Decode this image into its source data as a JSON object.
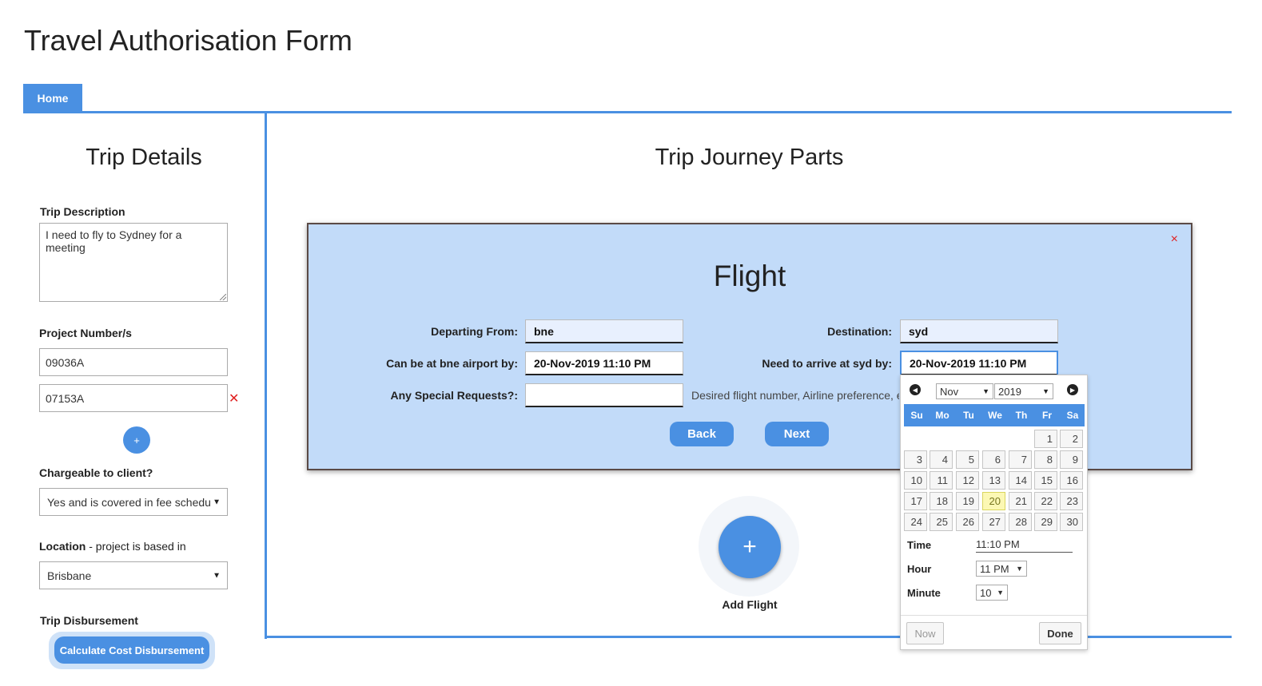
{
  "app": {
    "title": "Travel Authorisation Form"
  },
  "tabs": [
    {
      "label": "Home",
      "active": true
    }
  ],
  "left_panel": {
    "title": "Trip Details",
    "trip_description": {
      "label": "Trip Description",
      "value": "I need to fly to Sydney for a meeting"
    },
    "project_numbers": {
      "label": "Project Number/s",
      "values": [
        "09036A",
        "07153A"
      ],
      "remove_symbol": "✕",
      "add_symbol": "+"
    },
    "chargeable": {
      "label": "Chargeable to client?",
      "value": "Yes and is covered in fee schedu"
    },
    "location": {
      "label": "Location",
      "label_suffix": " - project is based in",
      "value": "Brisbane"
    },
    "disbursement": {
      "label": "Trip Disbursement",
      "button_label": "Calculate Cost Disbursement"
    }
  },
  "main": {
    "title": "Trip Journey Parts",
    "add_flight": {
      "symbol": "+",
      "label": "Add Flight"
    }
  },
  "flight_modal": {
    "title": "Flight",
    "close_symbol": "×",
    "departing_from": {
      "label": "Departing From:",
      "value": "bne"
    },
    "destination": {
      "label": "Destination:",
      "value": "syd"
    },
    "depart_by": {
      "label": "Can be at bne airport by:",
      "value": "20-Nov-2019 11:10 PM"
    },
    "arrive_by": {
      "label": "Need to arrive at syd by:",
      "value": "20-Nov-2019 11:10 PM"
    },
    "special_requests": {
      "label": "Any Special Requests?:",
      "value": "",
      "hint": "Desired flight number, Airline preference, e"
    },
    "back_label": "Back",
    "next_label": "Next"
  },
  "datepicker": {
    "month": "Nov",
    "year": "2019",
    "weekdays": [
      "Su",
      "Mo",
      "Tu",
      "We",
      "Th",
      "Fr",
      "Sa"
    ],
    "weeks": [
      [
        "",
        "",
        "",
        "",
        "",
        "1",
        "2"
      ],
      [
        "3",
        "4",
        "5",
        "6",
        "7",
        "8",
        "9"
      ],
      [
        "10",
        "11",
        "12",
        "13",
        "14",
        "15",
        "16"
      ],
      [
        "17",
        "18",
        "19",
        "20",
        "21",
        "22",
        "23"
      ],
      [
        "24",
        "25",
        "26",
        "27",
        "28",
        "29",
        "30"
      ]
    ],
    "selected_day": "20",
    "time": {
      "label": "Time",
      "value": "11:10 PM"
    },
    "hour": {
      "label": "Hour",
      "value": "11 PM"
    },
    "minute": {
      "label": "Minute",
      "value": "10"
    },
    "now_label": "Now",
    "done_label": "Done"
  },
  "colors": {
    "accent": "#4a90e2",
    "modal_bg": "#c2dbf9",
    "remove_red": "#e02020",
    "today_highlight": "#fcf8b4"
  }
}
